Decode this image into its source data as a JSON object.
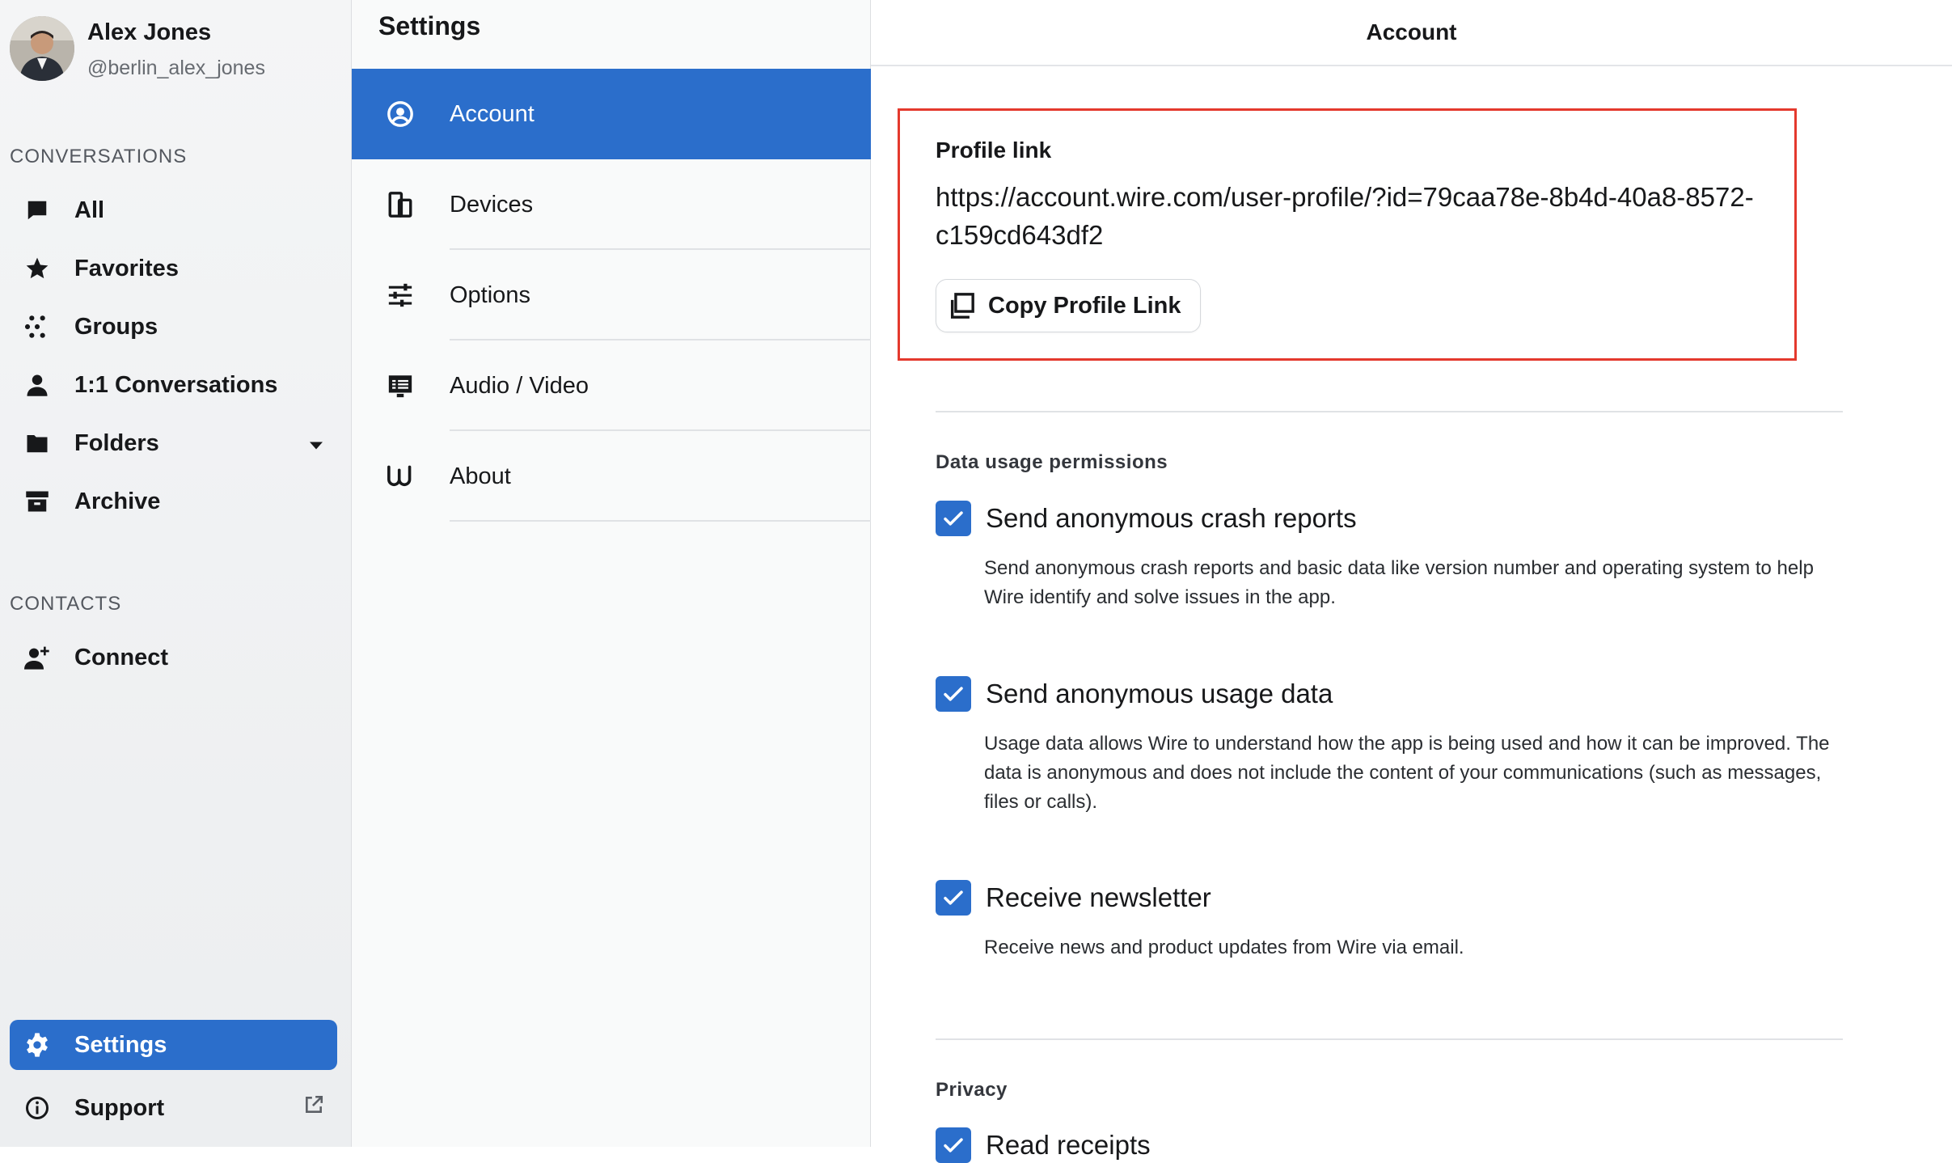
{
  "user": {
    "name": "Alex Jones",
    "handle": "@berlin_alex_jones"
  },
  "sidebar": {
    "conversations_label": "CONVERSATIONS",
    "items": [
      {
        "label": "All",
        "icon": "chat-bubble-icon"
      },
      {
        "label": "Favorites",
        "icon": "star-icon"
      },
      {
        "label": "Groups",
        "icon": "groups-dots-icon"
      },
      {
        "label": "1:1 Conversations",
        "icon": "person-icon"
      },
      {
        "label": "Folders",
        "icon": "folder-icon"
      },
      {
        "label": "Archive",
        "icon": "archive-icon"
      }
    ],
    "contacts_label": "CONTACTS",
    "connect_label": "Connect",
    "settings_label": "Settings",
    "support_label": "Support"
  },
  "settings": {
    "title": "Settings",
    "menu": [
      {
        "label": "Account",
        "icon": "account-circle-icon",
        "active": true
      },
      {
        "label": "Devices",
        "icon": "devices-icon"
      },
      {
        "label": "Options",
        "icon": "sliders-icon"
      },
      {
        "label": "Audio / Video",
        "icon": "audio-video-icon"
      },
      {
        "label": "About",
        "icon": "wire-logo-icon"
      }
    ]
  },
  "account": {
    "header": "Account",
    "profile_link_label": "Profile link",
    "profile_url": "https://account.wire.com/user-profile/?id=79caa78e-8b4d-40a8-8572-c159cd643df2",
    "copy_button": "Copy Profile Link",
    "data_usage_title": "Data usage permissions",
    "options": [
      {
        "title": "Send anonymous crash reports",
        "desc": "Send anonymous crash reports and basic data like version number and operating system to help Wire identify and solve issues in the app.",
        "checked": true
      },
      {
        "title": "Send anonymous usage data",
        "desc": "Usage data allows Wire to understand how the app is being used and how it can be improved. The data is anonymous and does not include the content of your communications (such as messages, files or calls).",
        "checked": true
      },
      {
        "title": "Receive newsletter",
        "desc": "Receive news and product updates from Wire via email.",
        "checked": true
      }
    ],
    "privacy_title": "Privacy",
    "read_receipts_label": "Read receipts"
  },
  "colors": {
    "accent": "#2b6ecb",
    "highlight_border": "#e4392d"
  }
}
